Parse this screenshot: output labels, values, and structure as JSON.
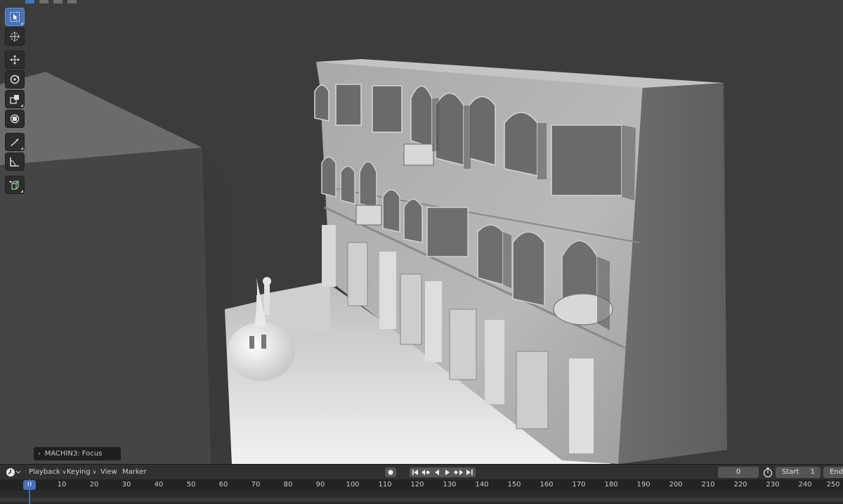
{
  "viewport": {
    "operator_panel": {
      "label": "MACHIN3: Focus"
    }
  },
  "toolbar": {
    "tools": [
      {
        "id": "select-box",
        "icon": "select-box-icon",
        "active": true
      },
      {
        "id": "cursor",
        "icon": "cursor-icon",
        "active": false
      },
      {
        "id": "move",
        "icon": "move-icon",
        "active": false
      },
      {
        "id": "rotate",
        "icon": "rotate-icon",
        "active": false
      },
      {
        "id": "scale",
        "icon": "scale-icon",
        "active": false
      },
      {
        "id": "transform",
        "icon": "transform-icon",
        "active": false
      },
      {
        "id": "annotate",
        "icon": "annotate-icon",
        "active": false
      },
      {
        "id": "measure",
        "icon": "measure-icon",
        "active": false
      },
      {
        "id": "add-cube",
        "icon": "add-cube-icon",
        "active": false
      }
    ]
  },
  "timeline": {
    "menus": {
      "playback": "Playback",
      "keying": "Keying",
      "view": "View",
      "marker": "Marker"
    },
    "current_frame": "0",
    "start_label": "Start",
    "start_value": "1",
    "end_label": "End",
    "ruler": [
      "0",
      "10",
      "20",
      "30",
      "40",
      "50",
      "60",
      "70",
      "80",
      "90",
      "100",
      "110",
      "120",
      "130",
      "140",
      "150",
      "160",
      "170",
      "180",
      "190",
      "200",
      "210",
      "220",
      "230",
      "240",
      "250"
    ]
  },
  "colors": {
    "accent": "#4772b3",
    "viewport_bg": "#3c3c3c",
    "header_bg": "#303030"
  }
}
